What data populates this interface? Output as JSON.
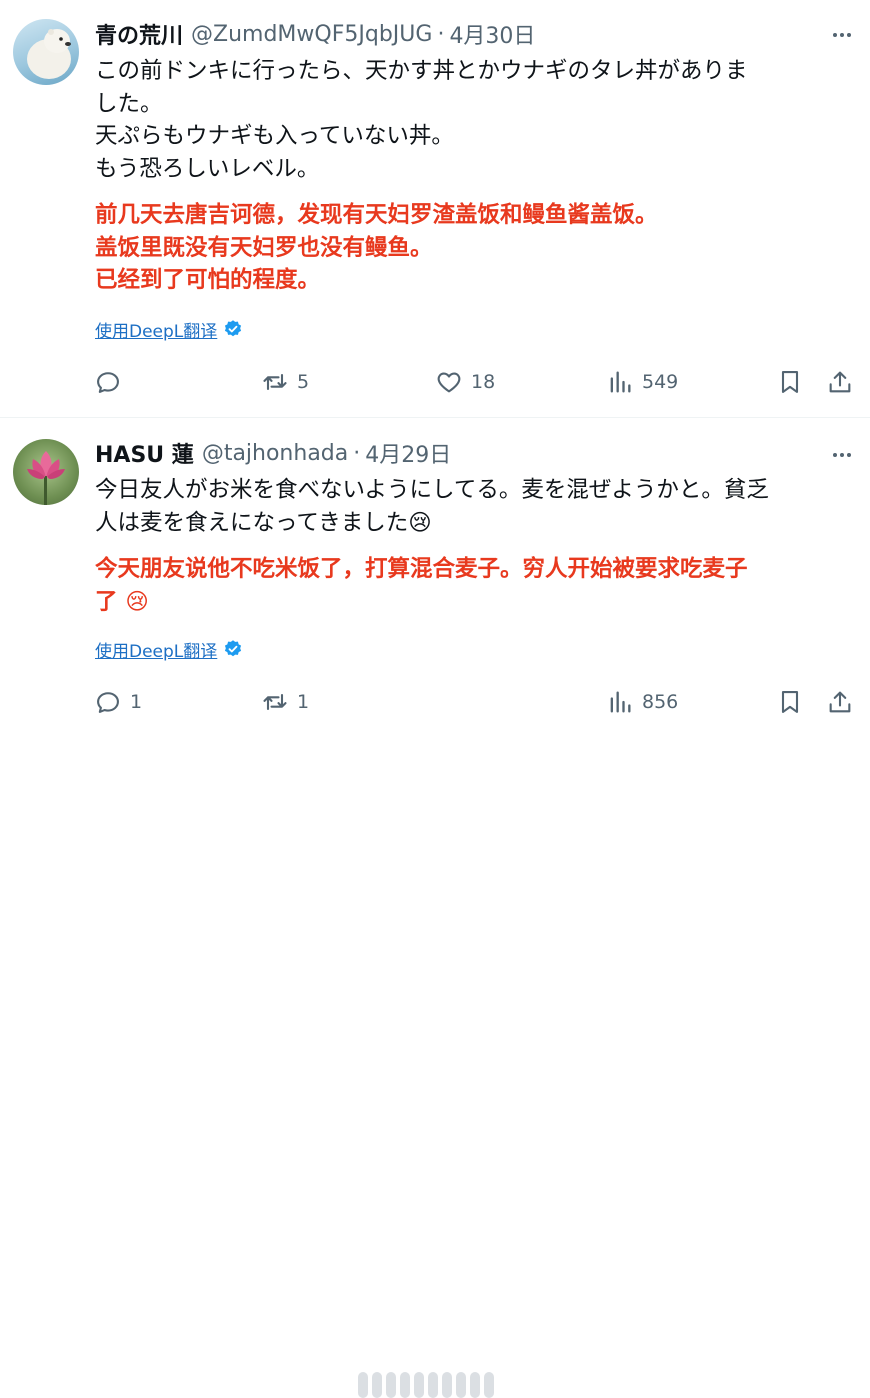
{
  "tweets": [
    {
      "display_name": "青の荒川",
      "handle": "@ZumdMwQF5JqbJUG",
      "separator": "·",
      "date": "4月30日",
      "body_lines": [
        "この前ドンキに行ったら、天かす丼とかウナギのタレ丼がありま",
        "した。",
        "天ぷらもウナギも入っていない丼。",
        "もう恐ろしいレベル。"
      ],
      "translation_lines": [
        "前几天去唐吉诃德，发现有天妇罗渣盖饭和鳗鱼酱盖饭。",
        "盖饭里既没有天妇罗也没有鳗鱼。",
        "已经到了可怕的程度。"
      ],
      "translate_link": "使用DeepL翻译",
      "reply_count": "",
      "retweet_count": "5",
      "like_count": "18",
      "view_count": "549"
    },
    {
      "display_name": "HASU 蓮",
      "handle": "@tajhonhada",
      "separator": "·",
      "date": "4月29日",
      "body_lines": [
        "今日友人がお米を食べないようにしてる。麦を混ぜようかと。貧乏",
        "人は麦を食えになってきました😢"
      ],
      "translation_lines": [
        "今天朋友说他不吃米饭了，打算混合麦子。穷人开始被要求吃麦子",
        "了 😢"
      ],
      "translate_link": "使用DeepL翻译",
      "reply_count": "1",
      "retweet_count": "1",
      "like_count": "",
      "view_count": "856"
    }
  ],
  "colors": {
    "text": "#0f1419",
    "secondary": "#536471",
    "translation": "#e8391e",
    "link": "#1d6fc4"
  },
  "icons": [
    "more-icon",
    "reply-icon",
    "retweet-icon",
    "like-icon",
    "views-icon",
    "bookmark-icon",
    "share-icon",
    "verified-badge-icon"
  ]
}
